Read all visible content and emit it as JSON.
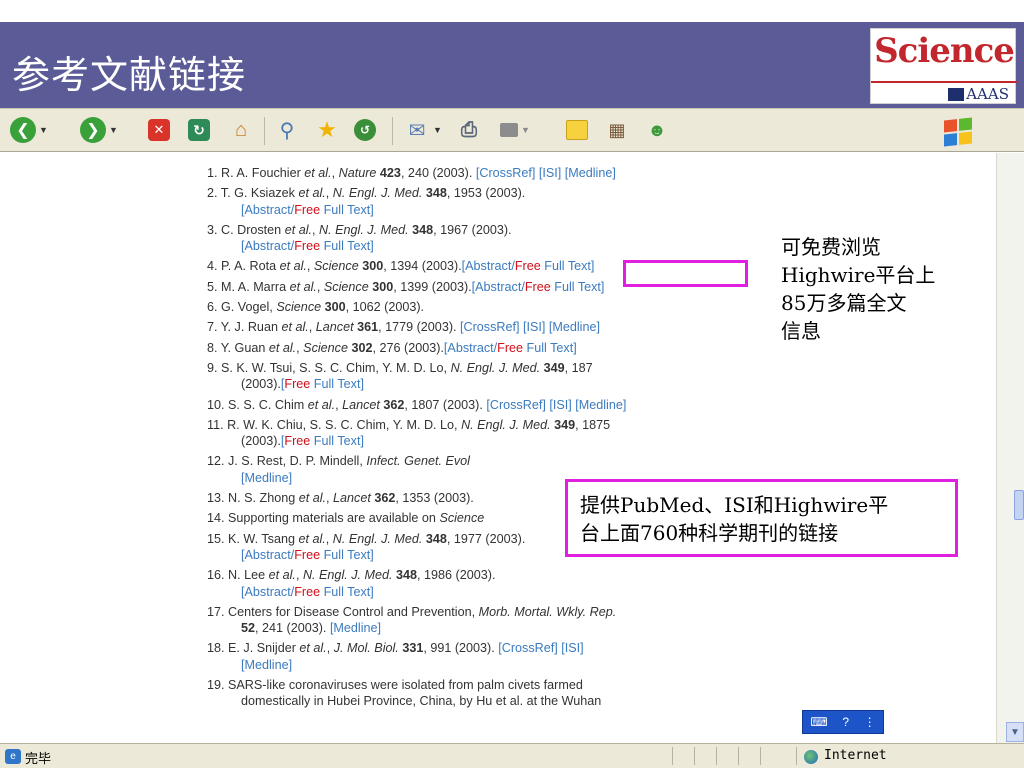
{
  "slide": {
    "title": "参考文献链接",
    "logo_text": "Science",
    "logo_sub": "AAAS"
  },
  "toolbar": {
    "icons": [
      "back-icon",
      "forward-icon",
      "stop-icon",
      "refresh-icon",
      "home-icon",
      "search-icon",
      "favorites-icon",
      "history-icon",
      "mail-icon",
      "print-icon",
      "edit-icon",
      "discuss-icon",
      "research-icon",
      "messenger-icon",
      "windows-logo-icon"
    ],
    "colors": {
      "back": "#3aa13a",
      "forward": "#3aa13a",
      "stop": "#d9332a",
      "refresh": "#2e8b57"
    }
  },
  "references": [
    {
      "parts": [
        [
          "t",
          "1. R. A. Fouchier "
        ],
        [
          "i",
          "et al."
        ],
        [
          "t",
          ", "
        ],
        [
          "i",
          "Nature"
        ],
        [
          "t",
          " "
        ],
        [
          "b",
          "423"
        ],
        [
          "t",
          ", 240 (2003). "
        ],
        [
          "l",
          "[CrossRef] [ISI] [Medline]"
        ]
      ]
    },
    {
      "parts": [
        [
          "t",
          "2. T. G. Ksiazek "
        ],
        [
          "i",
          "et al."
        ],
        [
          "t",
          ", "
        ],
        [
          "i",
          "N. Engl. J. Med."
        ],
        [
          "t",
          " "
        ],
        [
          "b",
          "348"
        ],
        [
          "t",
          ", 1953 (2003)."
        ]
      ],
      "hang": [
        [
          "l",
          "[Abstract/"
        ],
        [
          "f",
          "Free"
        ],
        [
          "l",
          " Full Text]"
        ]
      ]
    },
    {
      "parts": [
        [
          "t",
          "3. C. Drosten "
        ],
        [
          "i",
          "et al."
        ],
        [
          "t",
          ", "
        ],
        [
          "i",
          "N. Engl. J. Med."
        ],
        [
          "t",
          " "
        ],
        [
          "b",
          "348"
        ],
        [
          "t",
          ", 1967 (2003)."
        ]
      ],
      "hang": [
        [
          "l",
          "[Abstract/"
        ],
        [
          "f",
          "Free"
        ],
        [
          "l",
          " Full Text]"
        ]
      ]
    },
    {
      "parts": [
        [
          "t",
          "4. P. A. Rota "
        ],
        [
          "i",
          "et al."
        ],
        [
          "t",
          ", "
        ],
        [
          "i",
          "Science"
        ],
        [
          "t",
          " "
        ],
        [
          "b",
          "300"
        ],
        [
          "t",
          ", 1394 (2003)."
        ],
        [
          "l",
          "[Abstract/"
        ],
        [
          "f",
          "Free"
        ],
        [
          "l",
          " Full Text]"
        ]
      ]
    },
    {
      "parts": [
        [
          "t",
          "5. M. A. Marra "
        ],
        [
          "i",
          "et al."
        ],
        [
          "t",
          ", "
        ],
        [
          "i",
          "Science"
        ],
        [
          "t",
          " "
        ],
        [
          "b",
          "300"
        ],
        [
          "t",
          ", 1399 (2003)."
        ],
        [
          "l",
          "[Abstract/"
        ],
        [
          "f",
          "Free"
        ],
        [
          "l",
          " Full Text]"
        ]
      ]
    },
    {
      "parts": [
        [
          "t",
          "6. G. Vogel, "
        ],
        [
          "i",
          "Science"
        ],
        [
          "t",
          " "
        ],
        [
          "b",
          "300"
        ],
        [
          "t",
          ", 1062 (2003)."
        ]
      ]
    },
    {
      "parts": [
        [
          "t",
          "7. Y. J. Ruan "
        ],
        [
          "i",
          "et al."
        ],
        [
          "t",
          ", "
        ],
        [
          "i",
          "Lancet"
        ],
        [
          "t",
          " "
        ],
        [
          "b",
          "361"
        ],
        [
          "t",
          ", 1779 (2003). "
        ],
        [
          "l",
          "[CrossRef] [ISI] [Medline]"
        ]
      ]
    },
    {
      "parts": [
        [
          "t",
          "8. Y. Guan "
        ],
        [
          "i",
          "et al."
        ],
        [
          "t",
          ", "
        ],
        [
          "i",
          "Science"
        ],
        [
          "t",
          " "
        ],
        [
          "b",
          "302"
        ],
        [
          "t",
          ", 276 (2003)."
        ],
        [
          "l",
          "[Abstract/"
        ],
        [
          "f",
          "Free"
        ],
        [
          "l",
          " Full Text]"
        ]
      ]
    },
    {
      "parts": [
        [
          "t",
          "9. S. K. W. Tsui, S. S. C. Chim, Y. M. D. Lo, "
        ],
        [
          "i",
          "N. Engl. J. Med."
        ],
        [
          "t",
          " "
        ],
        [
          "b",
          "349"
        ],
        [
          "t",
          ", 187"
        ]
      ],
      "hang": [
        [
          "t",
          "(2003)."
        ],
        [
          "l",
          "["
        ],
        [
          "f",
          "Free"
        ],
        [
          "l",
          " Full Text]"
        ]
      ]
    },
    {
      "parts": [
        [
          "t",
          "10. S. S. C. Chim "
        ],
        [
          "i",
          "et al."
        ],
        [
          "t",
          ", "
        ],
        [
          "i",
          "Lancet"
        ],
        [
          "t",
          " "
        ],
        [
          "b",
          "362"
        ],
        [
          "t",
          ", 1807 (2003). "
        ],
        [
          "l",
          "[CrossRef] [ISI] [Medline]"
        ]
      ]
    },
    {
      "parts": [
        [
          "t",
          "11. R. W. K. Chiu, S. S. C. Chim, Y. M. D. Lo, "
        ],
        [
          "i",
          "N. Engl. J. Med."
        ],
        [
          "t",
          " "
        ],
        [
          "b",
          "349"
        ],
        [
          "t",
          ", 1875"
        ]
      ],
      "hang": [
        [
          "t",
          "(2003)."
        ],
        [
          "l",
          "["
        ],
        [
          "f",
          "Free"
        ],
        [
          "l",
          " Full Text]"
        ]
      ]
    },
    {
      "parts": [
        [
          "t",
          "12. J. S. Rest, D. P. Mindell, "
        ],
        [
          "i",
          "Infect. Genet. Evol"
        ]
      ],
      "hang": [
        [
          "l",
          "[Medline]"
        ]
      ]
    },
    {
      "parts": [
        [
          "t",
          "13. N. S. Zhong "
        ],
        [
          "i",
          "et al."
        ],
        [
          "t",
          ", "
        ],
        [
          "i",
          "Lancet"
        ],
        [
          "t",
          " "
        ],
        [
          "b",
          "362"
        ],
        [
          "t",
          ", 1353 (2003)."
        ]
      ]
    },
    {
      "parts": [
        [
          "t",
          "14. Supporting materials are available on "
        ],
        [
          "i",
          "Science"
        ]
      ]
    },
    {
      "parts": [
        [
          "t",
          "15. K. W. Tsang "
        ],
        [
          "i",
          "et al."
        ],
        [
          "t",
          ", "
        ],
        [
          "i",
          "N. Engl. J. Med."
        ],
        [
          "t",
          " "
        ],
        [
          "b",
          "348"
        ],
        [
          "t",
          ", 1977 (2003)."
        ]
      ],
      "hang": [
        [
          "l",
          "[Abstract/"
        ],
        [
          "f",
          "Free"
        ],
        [
          "l",
          " Full Text]"
        ]
      ]
    },
    {
      "parts": [
        [
          "t",
          "16. N. Lee "
        ],
        [
          "i",
          "et al."
        ],
        [
          "t",
          ", "
        ],
        [
          "i",
          "N. Engl. J. Med."
        ],
        [
          "t",
          " "
        ],
        [
          "b",
          "348"
        ],
        [
          "t",
          ", 1986 (2003)."
        ]
      ],
      "hang": [
        [
          "l",
          "[Abstract/"
        ],
        [
          "f",
          "Free"
        ],
        [
          "l",
          " Full Text]"
        ]
      ]
    },
    {
      "parts": [
        [
          "t",
          "17. Centers for Disease Control and Prevention, "
        ],
        [
          "i",
          "Morb. Mortal. Wkly. Rep."
        ]
      ],
      "hang": [
        [
          "b",
          "52"
        ],
        [
          "t",
          ", 241 (2003). "
        ],
        [
          "l",
          "[Medline]"
        ]
      ]
    },
    {
      "parts": [
        [
          "t",
          "18. E. J. Snijder "
        ],
        [
          "i",
          "et al."
        ],
        [
          "t",
          ", "
        ],
        [
          "i",
          "J. Mol. Biol."
        ],
        [
          "t",
          " "
        ],
        [
          "b",
          "331"
        ],
        [
          "t",
          ", 991 (2003). "
        ],
        [
          "l",
          "[CrossRef] [ISI]"
        ]
      ],
      "hang": [
        [
          "l",
          "[Medline]"
        ]
      ]
    },
    {
      "parts": [
        [
          "t",
          "19. SARS-like coronaviruses were isolated from palm civets farmed"
        ]
      ],
      "hang": [
        [
          "t",
          "domestically in Hubei Province, China, by Hu et al. at the Wuhan"
        ]
      ]
    }
  ],
  "annotations": {
    "note1": [
      "可免费浏览",
      "Highwire平台上",
      "85万多篇全文",
      "信息"
    ],
    "note2": [
      "提供PubMed、ISI和Highwire平",
      "台上面760种科学期刊的链接"
    ],
    "highlight_color": "#e020e0"
  },
  "statusbar": {
    "status": "完毕",
    "zone": "Internet"
  }
}
